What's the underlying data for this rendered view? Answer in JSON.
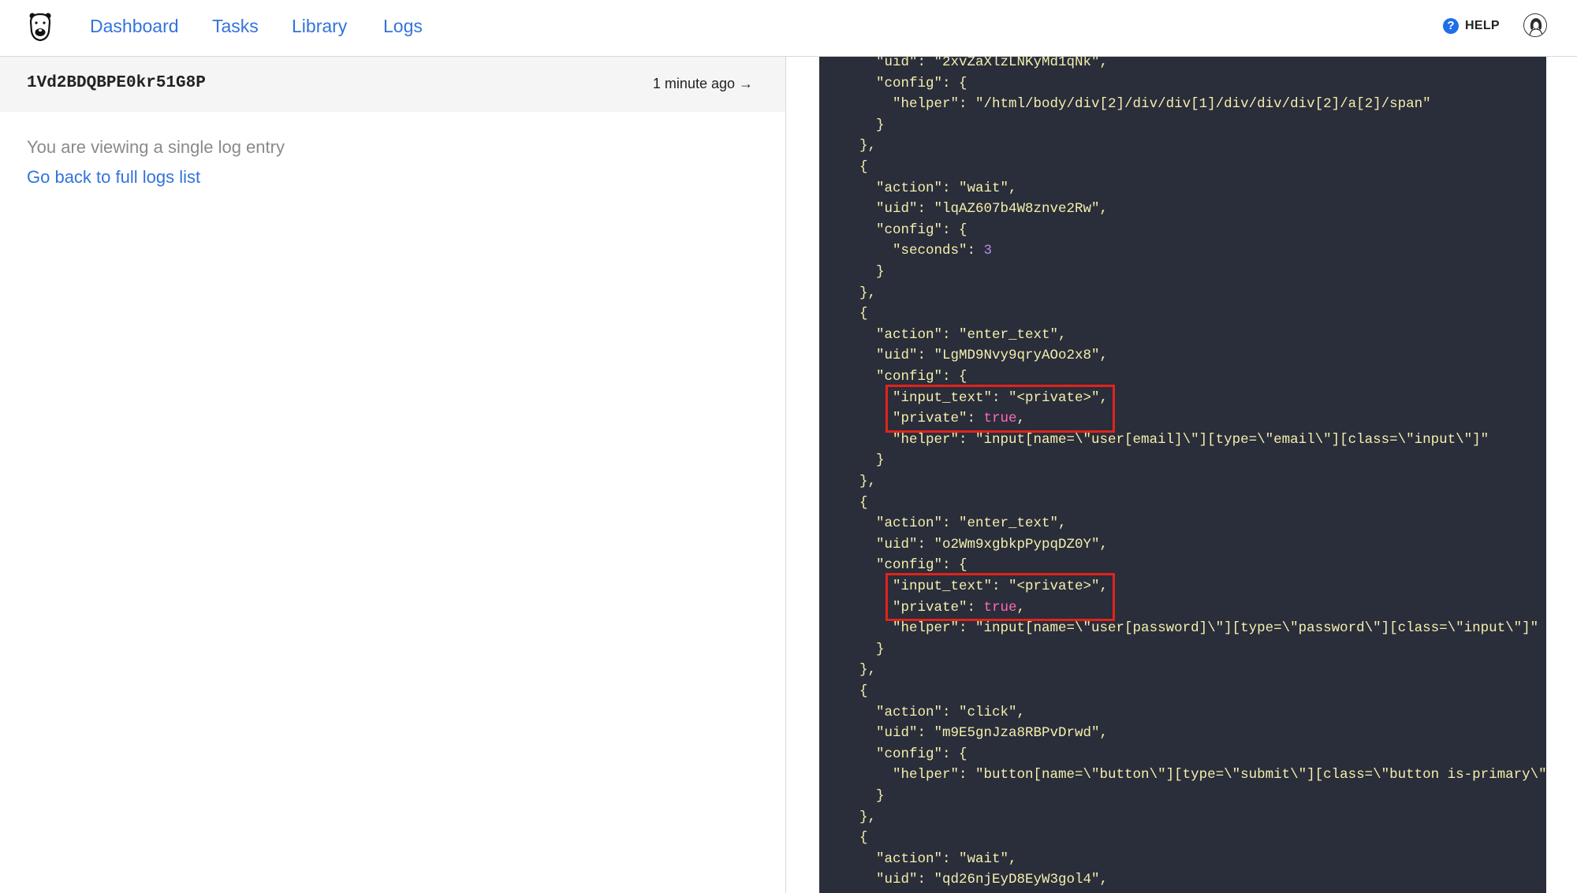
{
  "nav": {
    "logo_icon": "bear-logo-icon",
    "links": [
      "Dashboard",
      "Tasks",
      "Library",
      "Logs"
    ],
    "help_icon_glyph": "?",
    "help_label": "HELP",
    "avatar_icon": "user-avatar-icon"
  },
  "entry": {
    "id": "1Vd2BDQBPE0kr51G8P",
    "time": "1 minute ago →",
    "note": "You are viewing a single log entry",
    "back_link": "Go back to full logs list"
  },
  "code": {
    "lines": [
      "    \"uid\": \"2xvZaXlzLNKyMd1qNk\",",
      "    \"config\": {",
      "      \"helper\": \"/html/body/div[2]/div/div[1]/div/div/div[2]/a[2]/span\"",
      "    }",
      "  },",
      "  {",
      "    \"action\": \"wait\",",
      "    \"uid\": \"lqAZ607b4W8znve2Rw\",",
      "    \"config\": {",
      "      \"seconds\": 3",
      "    }",
      "  },",
      "  {",
      "    \"action\": \"enter_text\",",
      "    \"uid\": \"LgMD9Nvy9qryAOo2x8\",",
      "    \"config\": {",
      "      \"input_text\": \"<private>\",",
      "      \"private\": true,",
      "      \"helper\": \"input[name=\\\"user[email]\\\"][type=\\\"email\\\"][class=\\\"input\\\"]\"",
      "    }",
      "  },",
      "  {",
      "    \"action\": \"enter_text\",",
      "    \"uid\": \"o2Wm9xgbkpPypqDZ0Y\",",
      "    \"config\": {",
      "      \"input_text\": \"<private>\",",
      "      \"private\": true,",
      "      \"helper\": \"input[name=\\\"user[password]\\\"][type=\\\"password\\\"][class=\\\"input\\\"]\"",
      "    }",
      "  },",
      "  {",
      "    \"action\": \"click\",",
      "    \"uid\": \"m9E5gnJza8RBPvDrwd\",",
      "    \"config\": {",
      "      \"helper\": \"button[name=\\\"button\\\"][type=\\\"submit\\\"][class=\\\"button is-primary\\\"]\"",
      "    }",
      "  },",
      "  {",
      "    \"action\": \"wait\",",
      "    \"uid\": \"qd26njEyD8EyW3gol4\","
    ],
    "highlighted_line_ranges": [
      [
        16,
        17
      ],
      [
        25,
        26
      ]
    ],
    "colors": {
      "background": "#2a2d3a",
      "text": "#f4f0ad",
      "number": "#b48ee6",
      "boolean": "#ff6ab8",
      "highlight": "#e2231a"
    }
  }
}
